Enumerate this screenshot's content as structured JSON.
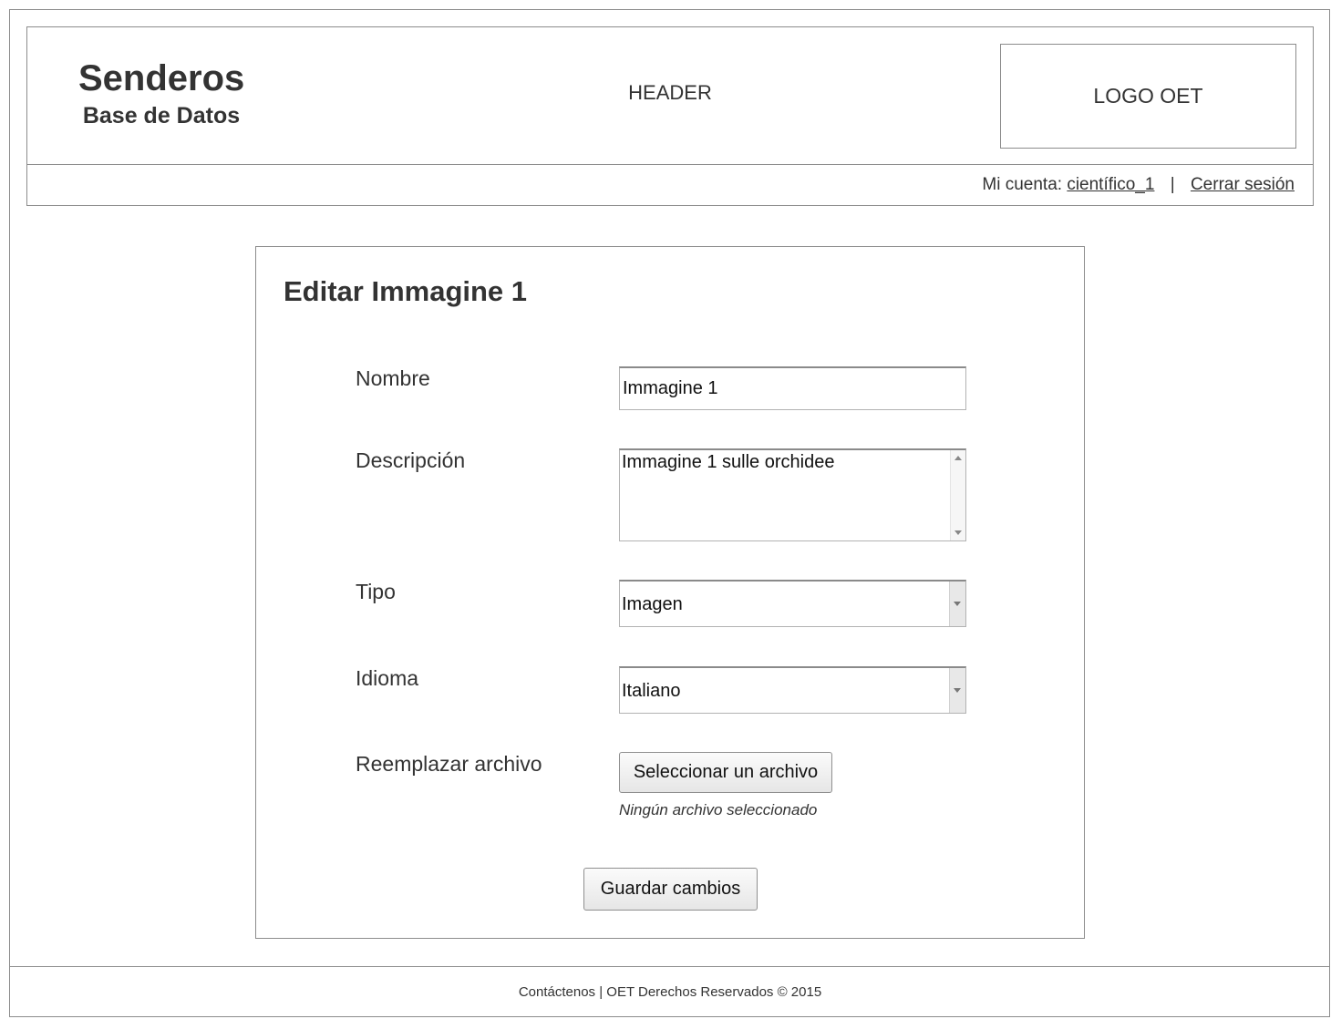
{
  "header": {
    "brand_title": "Senderos",
    "brand_subtitle": "Base de Datos",
    "center_label": "HEADER",
    "logo_label": "LOGO OET"
  },
  "account": {
    "prefix": "Mi cuenta:",
    "username": "científico_1",
    "separator": "|",
    "logout": "Cerrar sesión"
  },
  "form": {
    "title": "Editar Immagine 1",
    "fields": {
      "nombre": {
        "label": "Nombre",
        "value": "Immagine 1"
      },
      "descripcion": {
        "label": "Descripción",
        "value": "Immagine 1 sulle orchidee"
      },
      "tipo": {
        "label": "Tipo",
        "value": "Imagen"
      },
      "idioma": {
        "label": "Idioma",
        "value": "Italiano"
      },
      "archivo": {
        "label": "Reemplazar archivo",
        "button": "Seleccionar un archivo",
        "status": "Ningún archivo seleccionado"
      }
    },
    "submit": "Guardar cambios"
  },
  "footer": {
    "text": "Contáctenos | OET Derechos Reservados © 2015"
  }
}
